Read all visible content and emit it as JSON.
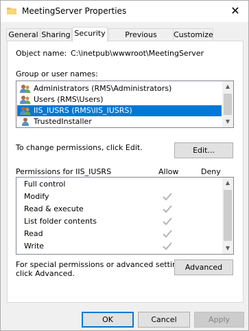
{
  "window": {
    "title": "MeetingServer Properties",
    "close_glyph": "✕"
  },
  "tabs": [
    {
      "label": "General"
    },
    {
      "label": "Sharing"
    },
    {
      "label": "Security",
      "active": true
    },
    {
      "label": "Previous Versions"
    },
    {
      "label": "Customize"
    }
  ],
  "object": {
    "label": "Object name:",
    "value": "C:\\inetpub\\wwwroot\\MeetingServer"
  },
  "groups": {
    "label": "Group or user names:",
    "items": [
      {
        "name": "Administrators (RMS\\Administrators)",
        "icon": "users-icon"
      },
      {
        "name": "Users (RMS\\Users)",
        "icon": "users-icon"
      },
      {
        "name": "IIS_IUSRS (RMS\\IIS_IUSRS)",
        "icon": "users-icon",
        "selected": true
      },
      {
        "name": "TrustedInstaller",
        "icon": "user-icon"
      }
    ]
  },
  "change_hint": "To change permissions, click Edit.",
  "edit_button": "Edit...",
  "permissions": {
    "header": "Permissions for IIS_IUSRS",
    "allow_header": "Allow",
    "deny_header": "Deny",
    "items": [
      {
        "name": "Full control",
        "allow": false,
        "deny": false
      },
      {
        "name": "Modify",
        "allow": true,
        "deny": false
      },
      {
        "name": "Read & execute",
        "allow": true,
        "deny": false
      },
      {
        "name": "List folder contents",
        "allow": true,
        "deny": false
      },
      {
        "name": "Read",
        "allow": true,
        "deny": false
      },
      {
        "name": "Write",
        "allow": true,
        "deny": false
      }
    ]
  },
  "advanced": {
    "hint_line1": "For special permissions or advanced settings,",
    "hint_line2": "click Advanced.",
    "button": "Advanced"
  },
  "footer": {
    "ok": "OK",
    "cancel": "Cancel",
    "apply": "Apply"
  },
  "colors": {
    "selection": "#0078d7",
    "check": "#b4b4b4"
  }
}
